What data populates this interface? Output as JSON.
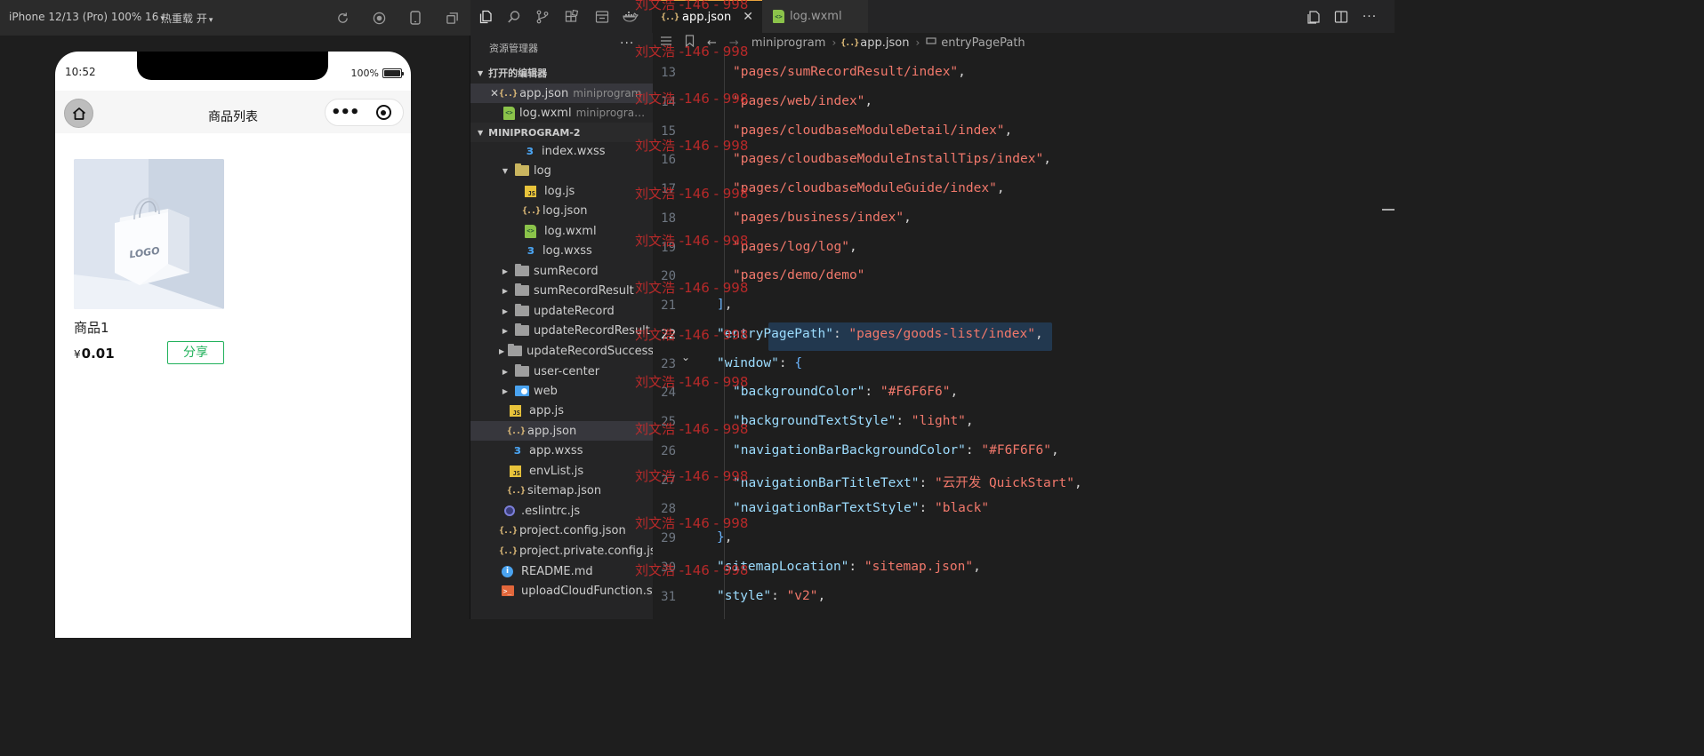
{
  "simulator": {
    "device_label": "iPhone 12/13 (Pro) 100% 16",
    "hot_reload_label": "热重载 开",
    "status": {
      "time": "10:52",
      "battery": "100%"
    },
    "page": {
      "nav_title": "商品列表",
      "capsule_more": "•••",
      "goods": [
        {
          "name": "商品1",
          "price_symbol": "¥",
          "price": "0.01",
          "share_label": "分享",
          "image_logo": "LOGO"
        }
      ]
    }
  },
  "tabs": [
    {
      "label": "app.json",
      "active": true
    },
    {
      "label": "log.wxml",
      "active": false
    }
  ],
  "explorer": {
    "title": "资源管理器",
    "more": "···",
    "open_editors_title": "打开的编辑器",
    "open_editors": [
      {
        "name": "app.json",
        "desc": "miniprogram",
        "close": "✕"
      },
      {
        "name": "log.wxml",
        "desc": "miniprogram\\..."
      }
    ],
    "project_title": "MINIPROGRAM-2",
    "tree": [
      {
        "name": "index.wxss"
      },
      {
        "name": "log"
      },
      {
        "name": "log.js"
      },
      {
        "name": "log.json"
      },
      {
        "name": "log.wxml"
      },
      {
        "name": "log.wxss"
      },
      {
        "name": "sumRecord"
      },
      {
        "name": "sumRecordResult"
      },
      {
        "name": "updateRecord"
      },
      {
        "name": "updateRecordResult"
      },
      {
        "name": "updateRecordSuccess"
      },
      {
        "name": "user-center"
      },
      {
        "name": "web"
      },
      {
        "name": "app.js"
      },
      {
        "name": "app.json"
      },
      {
        "name": "app.wxss"
      },
      {
        "name": "envList.js"
      },
      {
        "name": "sitemap.json"
      },
      {
        "name": ".eslintrc.js"
      },
      {
        "name": "project.config.json"
      },
      {
        "name": "project.private.config.js..."
      },
      {
        "name": "README.md"
      },
      {
        "name": "uploadCloudFunction.sh"
      }
    ]
  },
  "breadcrumb": [
    "miniprogram",
    "app.json",
    "entryPagePath"
  ],
  "editor": {
    "active_line": 22,
    "lines": [
      {
        "n": "13",
        "indent": 1,
        "parts": [
          [
            "s",
            "\"pages/sumRecordResult/index\""
          ],
          [
            "p",
            ","
          ]
        ]
      },
      {
        "n": "14",
        "indent": 1,
        "parts": [
          [
            "s",
            "\"pages/web/index\""
          ],
          [
            "p",
            ","
          ]
        ]
      },
      {
        "n": "15",
        "indent": 1,
        "parts": [
          [
            "s",
            "\"pages/cloudbaseModuleDetail/index\""
          ],
          [
            "p",
            ","
          ]
        ]
      },
      {
        "n": "16",
        "indent": 1,
        "parts": [
          [
            "s",
            "\"pages/cloudbaseModuleInstallTips/index\""
          ],
          [
            "p",
            ","
          ]
        ]
      },
      {
        "n": "17",
        "indent": 1,
        "parts": [
          [
            "s",
            "\"pages/cloudbaseModuleGuide/index\""
          ],
          [
            "p",
            ","
          ]
        ]
      },
      {
        "n": "18",
        "indent": 1,
        "parts": [
          [
            "s",
            "\"pages/business/index\""
          ],
          [
            "p",
            ","
          ]
        ]
      },
      {
        "n": "19",
        "indent": 1,
        "parts": [
          [
            "s",
            "\"pages/log/log\""
          ],
          [
            "p",
            ","
          ]
        ]
      },
      {
        "n": "20",
        "indent": 1,
        "parts": [
          [
            "s",
            "\"pages/demo/demo\""
          ]
        ]
      },
      {
        "n": "21",
        "indent": 0,
        "parts": [
          [
            "br",
            "]"
          ],
          [
            "p",
            ","
          ]
        ]
      },
      {
        "n": "22",
        "indent": 0,
        "parts": [
          [
            "k",
            "\"entryPagePath\""
          ],
          [
            "p",
            ": "
          ],
          [
            "s",
            "\"pages/goods-list/index\""
          ],
          [
            "p",
            ","
          ]
        ]
      },
      {
        "n": "23",
        "indent": 0,
        "parts": [
          [
            "k",
            "\"window\""
          ],
          [
            "p",
            ": "
          ],
          [
            "br",
            "{"
          ]
        ]
      },
      {
        "n": "24",
        "indent": 1,
        "parts": [
          [
            "k",
            "\"backgroundColor\""
          ],
          [
            "p",
            ": "
          ],
          [
            "s",
            "\"#F6F6F6\""
          ],
          [
            "p",
            ","
          ]
        ]
      },
      {
        "n": "25",
        "indent": 1,
        "parts": [
          [
            "k",
            "\"backgroundTextStyle\""
          ],
          [
            "p",
            ": "
          ],
          [
            "s",
            "\"light\""
          ],
          [
            "p",
            ","
          ]
        ]
      },
      {
        "n": "26",
        "indent": 1,
        "parts": [
          [
            "k",
            "\"navigationBarBackgroundColor\""
          ],
          [
            "p",
            ": "
          ],
          [
            "s",
            "\"#F6F6F6\""
          ],
          [
            "p",
            ","
          ]
        ]
      },
      {
        "n": "27",
        "indent": 1,
        "parts": [
          [
            "k",
            "\"navigationBarTitleText\""
          ],
          [
            "p",
            ": "
          ],
          [
            "s",
            "\"云开发 QuickStart\""
          ],
          [
            "p",
            ","
          ]
        ]
      },
      {
        "n": "28",
        "indent": 1,
        "parts": [
          [
            "k",
            "\"navigationBarTextStyle\""
          ],
          [
            "p",
            ": "
          ],
          [
            "s",
            "\"black\""
          ]
        ]
      },
      {
        "n": "29",
        "indent": 0,
        "parts": [
          [
            "br",
            "}"
          ],
          [
            "p",
            ","
          ]
        ]
      },
      {
        "n": "30",
        "indent": 0,
        "parts": [
          [
            "k",
            "\"sitemapLocation\""
          ],
          [
            "p",
            ": "
          ],
          [
            "s",
            "\"sitemap.json\""
          ],
          [
            "p",
            ","
          ]
        ]
      },
      {
        "n": "31",
        "indent": 0,
        "parts": [
          [
            "k",
            "\"style\""
          ],
          [
            "p",
            ": "
          ],
          [
            "s",
            "\"v2\""
          ],
          [
            "p",
            ","
          ]
        ]
      }
    ]
  },
  "watermark": "刘文浩 -146 - 998",
  "colors": {
    "string": "#f1786b",
    "key": "#9cdcfe",
    "accent_tab": "#e8a33d",
    "share_green": "#20b15a",
    "watermark": "#d42b2b"
  }
}
